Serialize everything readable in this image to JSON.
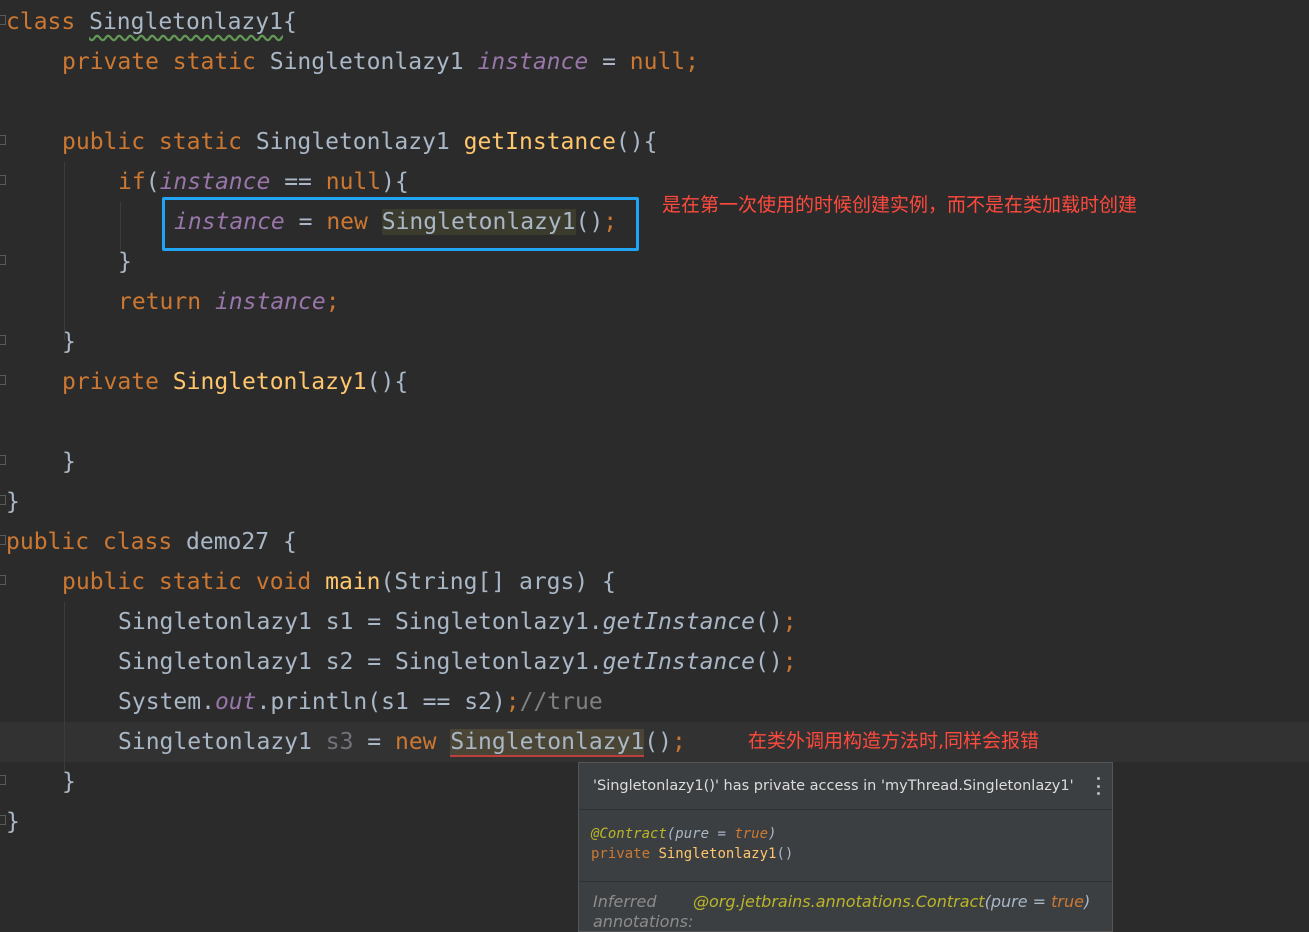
{
  "editor": {
    "lines": [
      [
        {
          "t": "class ",
          "c": "kw"
        },
        {
          "t": "Singletonlazy1",
          "c": "plain typo-u"
        },
        {
          "t": "{",
          "c": "plain"
        }
      ],
      [
        {
          "t": "private static ",
          "c": "kw"
        },
        {
          "t": "Singletonlazy1 ",
          "c": "plain"
        },
        {
          "t": "instance",
          "c": "field"
        },
        {
          "t": " = ",
          "c": "plain"
        },
        {
          "t": "null",
          "c": "kw"
        },
        {
          "t": ";",
          "c": "kw"
        }
      ],
      [],
      [
        {
          "t": "public static ",
          "c": "kw"
        },
        {
          "t": "Singletonlazy1 ",
          "c": "plain"
        },
        {
          "t": "getInstance",
          "c": "fn"
        },
        {
          "t": "(){",
          "c": "plain"
        }
      ],
      [
        {
          "t": "if",
          "c": "kw"
        },
        {
          "t": "(",
          "c": "plain"
        },
        {
          "t": "instance",
          "c": "field"
        },
        {
          "t": " == ",
          "c": "plain"
        },
        {
          "t": "null",
          "c": "kw"
        },
        {
          "t": "){",
          "c": "plain"
        }
      ],
      [
        {
          "t": "instance",
          "c": "field"
        },
        {
          "t": " = ",
          "c": "plain"
        },
        {
          "t": "new ",
          "c": "kw"
        },
        {
          "t": "Singletonlazy1",
          "c": "plain hl-usage"
        },
        {
          "t": "()",
          "c": "plain"
        },
        {
          "t": ";",
          "c": "kw"
        }
      ],
      [
        {
          "t": "}",
          "c": "plain"
        }
      ],
      [
        {
          "t": "return ",
          "c": "kw"
        },
        {
          "t": "instance",
          "c": "field"
        },
        {
          "t": ";",
          "c": "kw"
        }
      ],
      [
        {
          "t": "}",
          "c": "plain"
        }
      ],
      [
        {
          "t": "private ",
          "c": "kw"
        },
        {
          "t": "Singletonlazy1",
          "c": "fn"
        },
        {
          "t": "(){",
          "c": "plain"
        }
      ],
      [],
      [
        {
          "t": "}",
          "c": "plain"
        }
      ],
      [
        {
          "t": "}",
          "c": "plain"
        }
      ],
      [
        {
          "t": "public class ",
          "c": "kw"
        },
        {
          "t": "demo27 {",
          "c": "plain"
        }
      ],
      [
        {
          "t": "public static void ",
          "c": "kw"
        },
        {
          "t": "main",
          "c": "fn"
        },
        {
          "t": "(String[] args) {",
          "c": "plain"
        }
      ],
      [
        {
          "t": "Singletonlazy1 s1 = Singletonlazy1.",
          "c": "plain"
        },
        {
          "t": "getInstance",
          "c": "static-call"
        },
        {
          "t": "()",
          "c": "plain"
        },
        {
          "t": ";",
          "c": "kw"
        }
      ],
      [
        {
          "t": "Singletonlazy1 s2 = Singletonlazy1.",
          "c": "plain"
        },
        {
          "t": "getInstance",
          "c": "static-call"
        },
        {
          "t": "()",
          "c": "plain"
        },
        {
          "t": ";",
          "c": "kw"
        }
      ],
      [
        {
          "t": "System.",
          "c": "plain"
        },
        {
          "t": "out",
          "c": "field"
        },
        {
          "t": ".println(s1 == s2)",
          "c": "plain"
        },
        {
          "t": ";",
          "c": "kw"
        },
        {
          "t": "//true",
          "c": "comment"
        }
      ],
      [
        {
          "t": "Singletonlazy1 ",
          "c": "plain"
        },
        {
          "t": "s3",
          "c": "unused"
        },
        {
          "t": " = ",
          "c": "plain"
        },
        {
          "t": "new ",
          "c": "kw"
        },
        {
          "t": "Singletonlazy1",
          "c": "plain hl-err"
        },
        {
          "t": "()",
          "c": "plain"
        },
        {
          "t": ";",
          "c": "kw"
        }
      ],
      [
        {
          "t": "}",
          "c": "plain"
        }
      ],
      [
        {
          "t": "}",
          "c": "plain"
        }
      ]
    ]
  },
  "annotations": {
    "note1": "是在第一次使用的时候创建实例，而不是在类加载时创建",
    "note2": "在类外调用构造方法时,同样会报错"
  },
  "popup": {
    "message": "'Singletonlazy1()' has private access in 'myThread.Singletonlazy1'",
    "sig_annotation": "@Contract",
    "sig_params_open": "(",
    "sig_param_name": "pure",
    "sig_eq": " = ",
    "sig_param_value": "true",
    "sig_params_close": ")",
    "sig_mod": "private ",
    "sig_name": "Singletonlazy1",
    "sig_tail": "()",
    "inferred_label": "Inferred annotations:",
    "inferred_prefix": "@org.jetbrains.annotations.Contract",
    "inferred_open": "(",
    "inferred_param": "pure = ",
    "inferred_value": "true",
    "inferred_close": ")",
    "menu_icon": "more-vertical-icon"
  },
  "colors": {
    "background": "#2b2b2b",
    "keyword": "#cc7832",
    "function": "#ffc66d",
    "field": "#9876aa",
    "annotation_box": "#20a4f3",
    "annotation_text": "#ff4a3d"
  }
}
